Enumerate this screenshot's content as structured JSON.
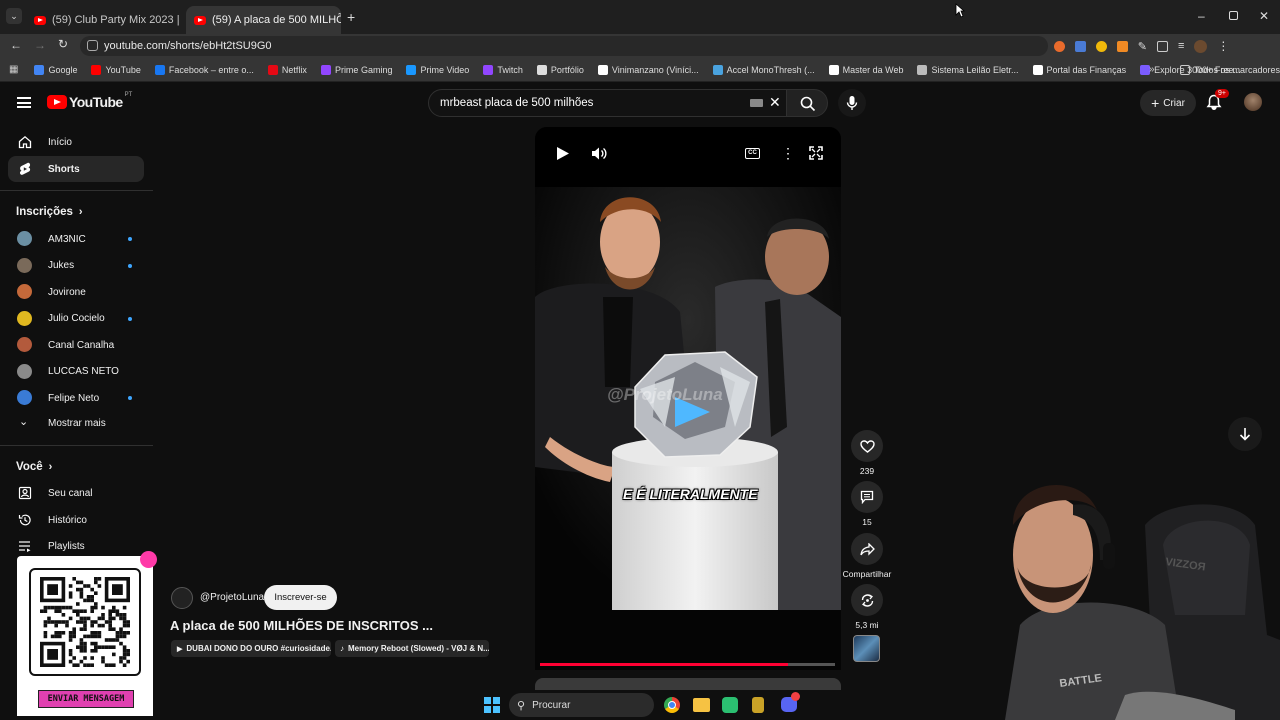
{
  "browser": {
    "tabs": [
      {
        "title": "(59) Club Party Mix 2023 | Mas",
        "active": false
      },
      {
        "title": "(59) A placa de 500 MILHÕ",
        "active": true
      }
    ],
    "url": "youtube.com/shorts/ebHt2tSU9G0",
    "bookmarks": [
      {
        "label": "Google",
        "color": "#4285f4"
      },
      {
        "label": "YouTube",
        "color": "#ff0000"
      },
      {
        "label": "Facebook – entre o...",
        "color": "#1877f2"
      },
      {
        "label": "Netflix",
        "color": "#e50914"
      },
      {
        "label": "Prime Gaming",
        "color": "#9146ff"
      },
      {
        "label": "Prime Video",
        "color": "#1a98ff"
      },
      {
        "label": "Twitch",
        "color": "#9146ff"
      },
      {
        "label": "Portfólio",
        "color": "#dddddd"
      },
      {
        "label": "Vinimanzano (Viníci...",
        "color": "#ffffff"
      },
      {
        "label": "Accel MonoThresh (...",
        "color": "#4aa3df"
      },
      {
        "label": "Master da Web",
        "color": "#ffffff"
      },
      {
        "label": "Sistema Leilão Eletr...",
        "color": "#bbbbbb"
      },
      {
        "label": "Portal das Finanças",
        "color": "#ffffff"
      },
      {
        "label": "Explore 3000+ Free...",
        "color": "#7b5cff"
      }
    ],
    "all_bookmarks": "Todos os marcadores"
  },
  "youtube": {
    "logo_text": "YouTube",
    "logo_region": "PT",
    "search_query": "mrbeast placa de 500 milhões",
    "create_label": "Criar",
    "notification_count": "9+",
    "sidebar": {
      "main": [
        {
          "label": "Início",
          "icon": "home-icon"
        },
        {
          "label": "Shorts",
          "icon": "shorts-icon",
          "active": true
        }
      ],
      "subscriptions_title": "Inscrições",
      "subscriptions": [
        {
          "label": "AM3NIC",
          "color": "#6b8fa3",
          "dot": true
        },
        {
          "label": "Jukes",
          "color": "#7a6a5a",
          "dot": true
        },
        {
          "label": "Jovirone",
          "color": "#c4693a",
          "dot": false
        },
        {
          "label": "Julio Cocielo",
          "color": "#e0b820",
          "dot": true
        },
        {
          "label": "Canal Canalha",
          "color": "#b35a3c",
          "dot": false
        },
        {
          "label": "LUCCAS NETO",
          "color": "#8a8a8a",
          "dot": false
        },
        {
          "label": "Felipe Neto",
          "color": "#3a7bd5",
          "dot": true
        }
      ],
      "show_more": "Mostrar mais",
      "you_title": "Você",
      "you_items": [
        {
          "label": "Seu canal",
          "icon": "channel-icon"
        },
        {
          "label": "Histórico",
          "icon": "history-icon"
        },
        {
          "label": "Playlists",
          "icon": "playlists-icon"
        }
      ]
    },
    "short": {
      "channel": "@ProjetoLuna",
      "subscribe_label": "Inscrever-se",
      "title": "A placa de 500 MILHÕES DE INSCRITOS ...",
      "chips": [
        "DUBAI DONO DO OURO #curiosidade...",
        "Memory Reboot (Slowed) - VØJ & N..."
      ],
      "caption": "E É LITERALMENTE",
      "watermark": "@ProjetoLuna",
      "progress": 0.84,
      "likes": "239",
      "comments": "15",
      "share_label": "Compartilhar",
      "remix": "5,3 mi"
    }
  },
  "overlay": {
    "send_message": "ENVIAR MENSAGEM"
  },
  "taskbar": {
    "search_placeholder": "Procurar"
  }
}
